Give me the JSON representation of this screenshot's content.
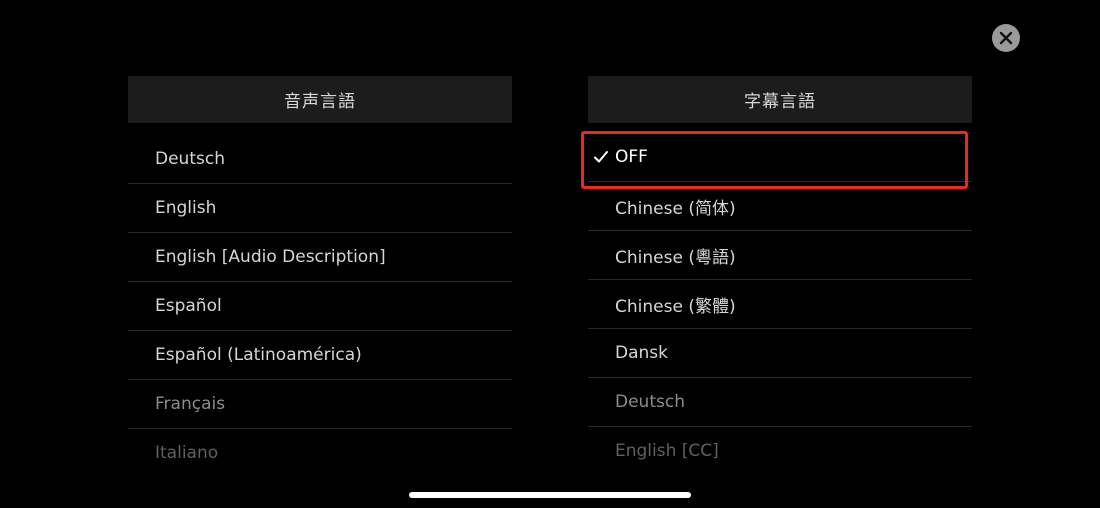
{
  "close_icon": "close-icon",
  "audio": {
    "header": "音声言語",
    "items": [
      {
        "label": "Deutsch"
      },
      {
        "label": "English"
      },
      {
        "label": "English [Audio Description]"
      },
      {
        "label": "Español"
      },
      {
        "label": "Español (Latinoamérica)"
      },
      {
        "label": "Français"
      },
      {
        "label": "Italiano"
      }
    ]
  },
  "subtitles": {
    "header": "字幕言語",
    "selected_index": 0,
    "items": [
      {
        "label": "OFF",
        "selected": true
      },
      {
        "label": "Chinese (简体)"
      },
      {
        "label": "Chinese (粵語)"
      },
      {
        "label": "Chinese (繁體)"
      },
      {
        "label": "Dansk"
      },
      {
        "label": "Deutsch"
      },
      {
        "label": "English [CC]"
      }
    ]
  },
  "colors": {
    "highlight": "#f0281a",
    "header_bg": "#1c1c1c",
    "background": "#000000"
  }
}
